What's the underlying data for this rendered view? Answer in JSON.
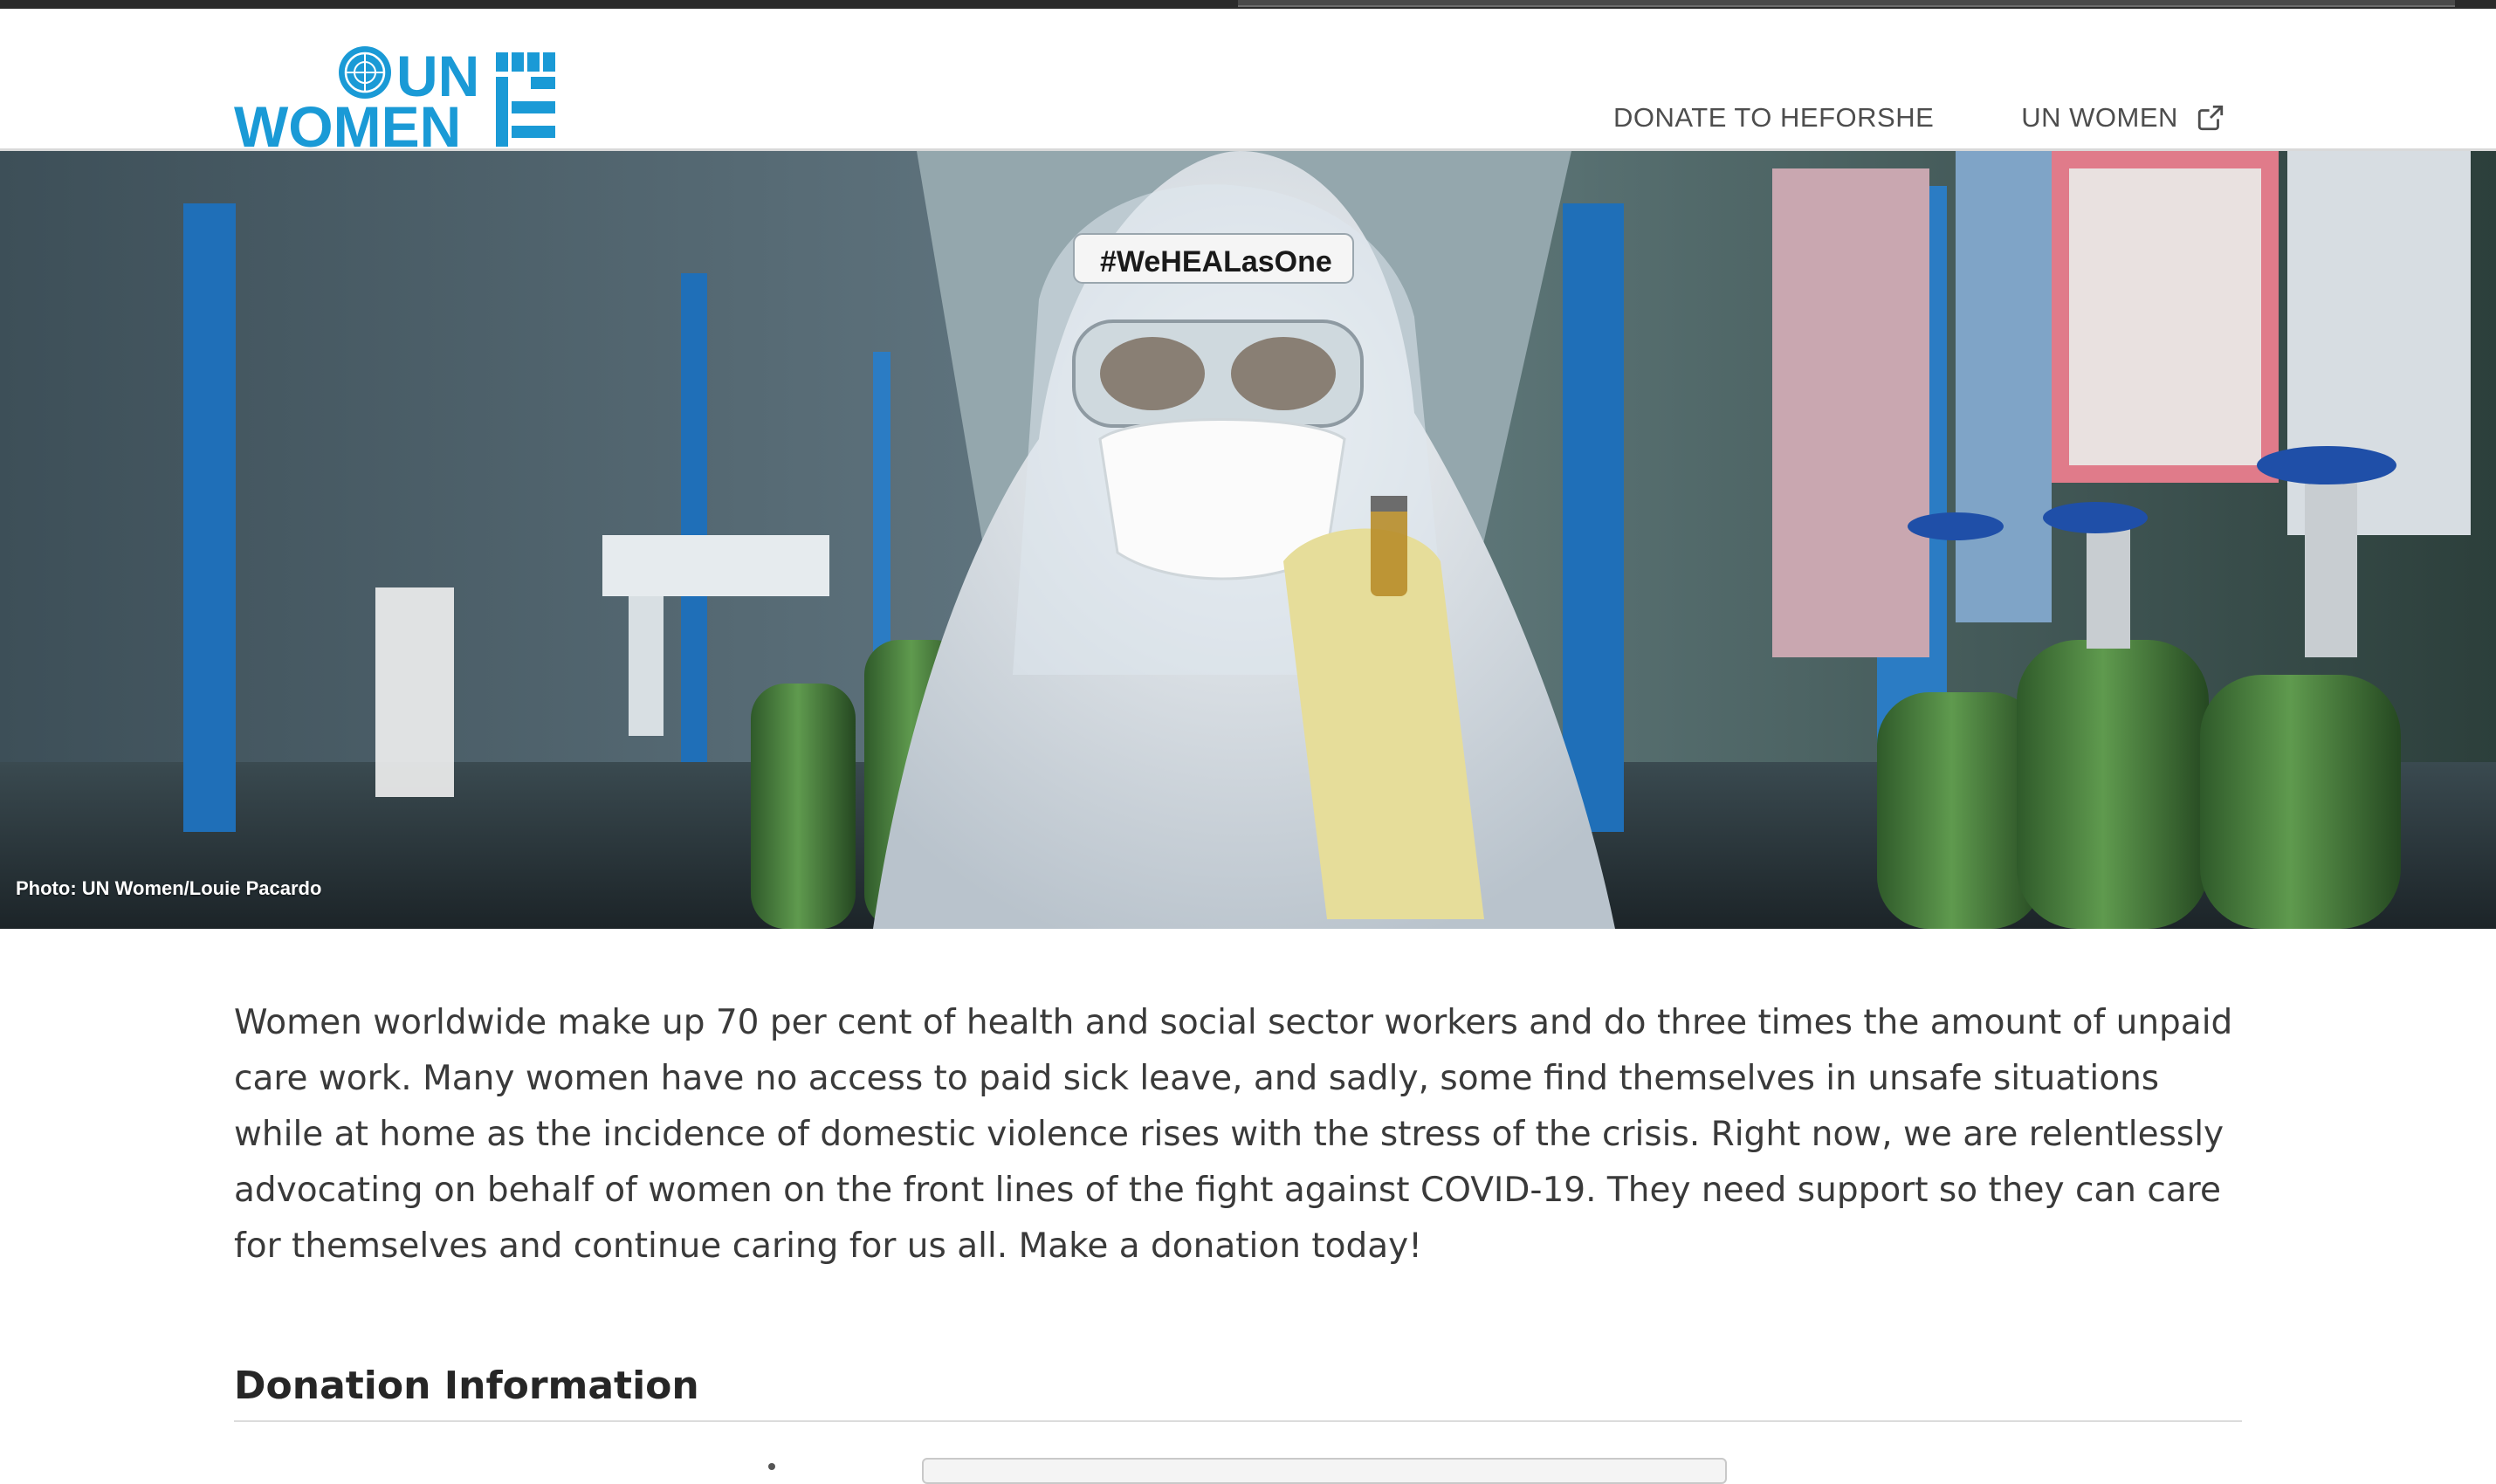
{
  "header": {
    "logo_text_line1": "UN",
    "logo_text_line2": "WOMEN",
    "brand_color": "#1a9ad6",
    "nav": [
      {
        "label": "DONATE TO HEFORSHE"
      },
      {
        "label": "UN WOMEN",
        "icon": "external-link-icon"
      }
    ]
  },
  "hero": {
    "photo_credit": "Photo: UN Women/Louie Pacardo",
    "headband_text": "#WeHEALasOne"
  },
  "main": {
    "intro": "Women worldwide make up 70 per cent of health and social sector workers and do three times the amount of unpaid care work. Many women have no access to paid sick leave, and sadly, some find themselves in unsafe situations while at home as the incidence of domestic violence rises with the stress of the crisis. Right now, we are relentlessly advocating on behalf of women on the front lines of the fight against COVID-19. They need support so they can care for themselves and continue caring for us all. Make a donation today!",
    "section_title": "Donation Information"
  }
}
